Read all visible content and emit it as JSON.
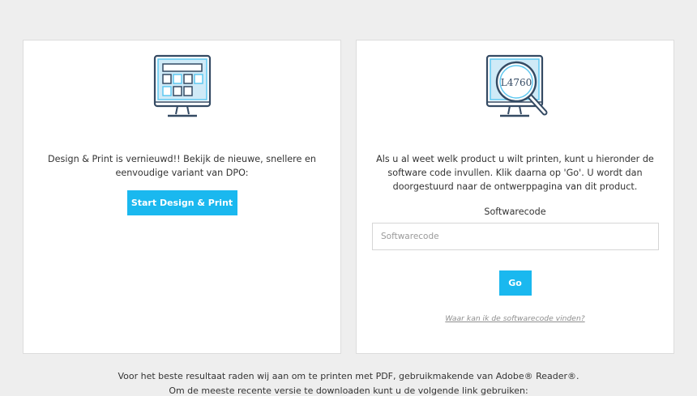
{
  "design_print": {
    "description": "Design & Print is vernieuwd!! Bekijk de nieuwe, snellere en eenvoudige variant van DPO:",
    "button_label": "Start Design & Print",
    "icon": "monitor-layout-icon"
  },
  "software_code": {
    "description": "Als u al weet welk product u wilt printen, kunt u hieronder de software code invullen. Klik daarna op 'Go'. U wordt dan doorgestuurd naar de ontwerppagina van dit product.",
    "illustration_code": "L4760",
    "icon": "monitor-magnifier-icon",
    "field_label": "Softwarecode",
    "input_value": "",
    "input_placeholder": "Softwarecode",
    "button_label": "Go",
    "help_link": "Waar kan ik de softwarecode vinden?"
  },
  "footer": {
    "line1": "Voor het beste resultaat raden wij aan om te printen met PDF, gebruikmakende van Adobe® Reader®.",
    "line2": "Om de meeste recente versie te downloaden kunt u de volgende link gebruiken:"
  },
  "colors": {
    "accent": "#1ab8ef",
    "icon_stroke": "#344a63",
    "icon_fill_light": "#cfeaf7",
    "icon_highlight": "#5fc8f0",
    "page_background": "#eeeeee"
  }
}
